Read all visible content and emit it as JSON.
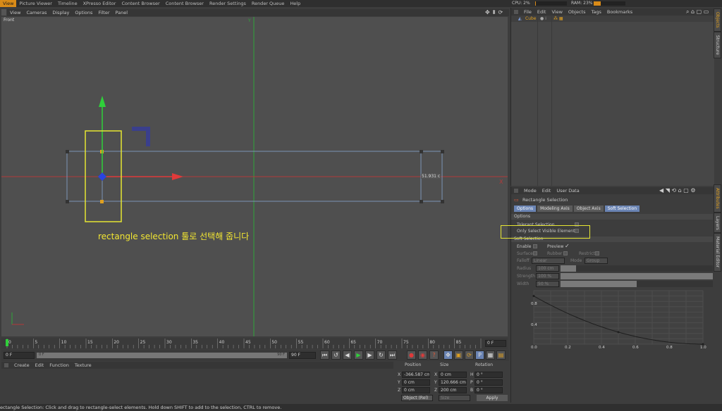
{
  "top_menu": [
    "View",
    "Picture Viewer",
    "Timeline",
    "XPresso Editor",
    "Content Browser",
    "Content Browser",
    "Render Settings",
    "Render Queue",
    "Help"
  ],
  "cpu": {
    "cpu_label": "CPU: 2%",
    "cpu_level": 0.02,
    "ram_label": "RAM: 23%",
    "ram_level": 0.23
  },
  "viewport": {
    "menu": [
      "View",
      "Cameras",
      "Display",
      "Options",
      "Filter",
      "Panel"
    ],
    "name": "Front",
    "readout": "51.931 c",
    "axis_x": "X",
    "axis_y": "Y"
  },
  "annotation_text": "rectangle selection 툴로 선택해 줍니다",
  "timeline": {
    "ticks": [
      "0",
      "5",
      "10",
      "15",
      "20",
      "25",
      "30",
      "35",
      "40",
      "45",
      "50",
      "55",
      "60",
      "65",
      "70",
      "75",
      "80",
      "85",
      "90"
    ],
    "frame_right": "0 F",
    "start": "0 F",
    "range_end": "90 F",
    "end": "90 F",
    "playhead_value": "0 F"
  },
  "material": {
    "menu": [
      "Create",
      "Edit",
      "Function",
      "Texture"
    ]
  },
  "coords": {
    "headers": [
      "Position",
      "Size",
      "Rotation"
    ],
    "rows": [
      {
        "axis": "X",
        "pos": "-366.587 cm",
        "size_axis": "X",
        "size": "0 cm",
        "rot_axis": "H",
        "rot": "0 °"
      },
      {
        "axis": "Y",
        "pos": "0 cm",
        "size_axis": "Y",
        "size": "120.666 cm",
        "rot_axis": "P",
        "rot": "0 °"
      },
      {
        "axis": "Z",
        "pos": "0 cm",
        "size_axis": "Z",
        "size": "200 cm",
        "rot_axis": "B",
        "rot": "0 °"
      }
    ],
    "mode": "Object (Rel)",
    "size_mode": "Size",
    "apply": "Apply"
  },
  "objects": {
    "menu": [
      "File",
      "Edit",
      "View",
      "Objects",
      "Tags",
      "Bookmarks"
    ],
    "items": [
      {
        "name": "Cube"
      }
    ]
  },
  "attributes": {
    "menu": [
      "Mode",
      "Edit",
      "User Data"
    ],
    "tool_name": "Rectangle Selection",
    "tabs": [
      {
        "label": "Options",
        "selected": true
      },
      {
        "label": "Modeling Axis",
        "selected": false
      },
      {
        "label": "Object Axis",
        "selected": false
      },
      {
        "label": "Soft Selection",
        "selected": true
      }
    ],
    "options_header": "Options",
    "tolerant_selection": "Tolerant Selection",
    "only_select_visible": "Only Select Visible Elements",
    "soft_selection_header": "Soft Selection",
    "enable": "Enable",
    "preview": "Preview",
    "surface": "Surface",
    "rubber": "Rubber",
    "restrict": "Restrict",
    "falloff_label": "Falloff",
    "falloff_value": "Linear",
    "mode_label": "Mode",
    "mode_value": "Group",
    "radius_label": "Radius",
    "radius_value": "100 cm",
    "strength_label": "Strength",
    "strength_value": "100 %",
    "width_label": "Width",
    "width_value": "50 %",
    "graph_y_ticks": [
      "0.8",
      "0.4"
    ],
    "graph_x_ticks": [
      "0.0",
      "0.2",
      "0.4",
      "0.6",
      "0.8",
      "1.0"
    ]
  },
  "side_tabs": {
    "top": [
      "Objects",
      "Structure"
    ],
    "bottom": [
      "Attributes",
      "Layers",
      "Material Editor"
    ]
  },
  "status_text": "ectangle Selection: Click and drag to rectangle-select elements. Hold down SHIFT to add to the selection, CTRL to remove."
}
